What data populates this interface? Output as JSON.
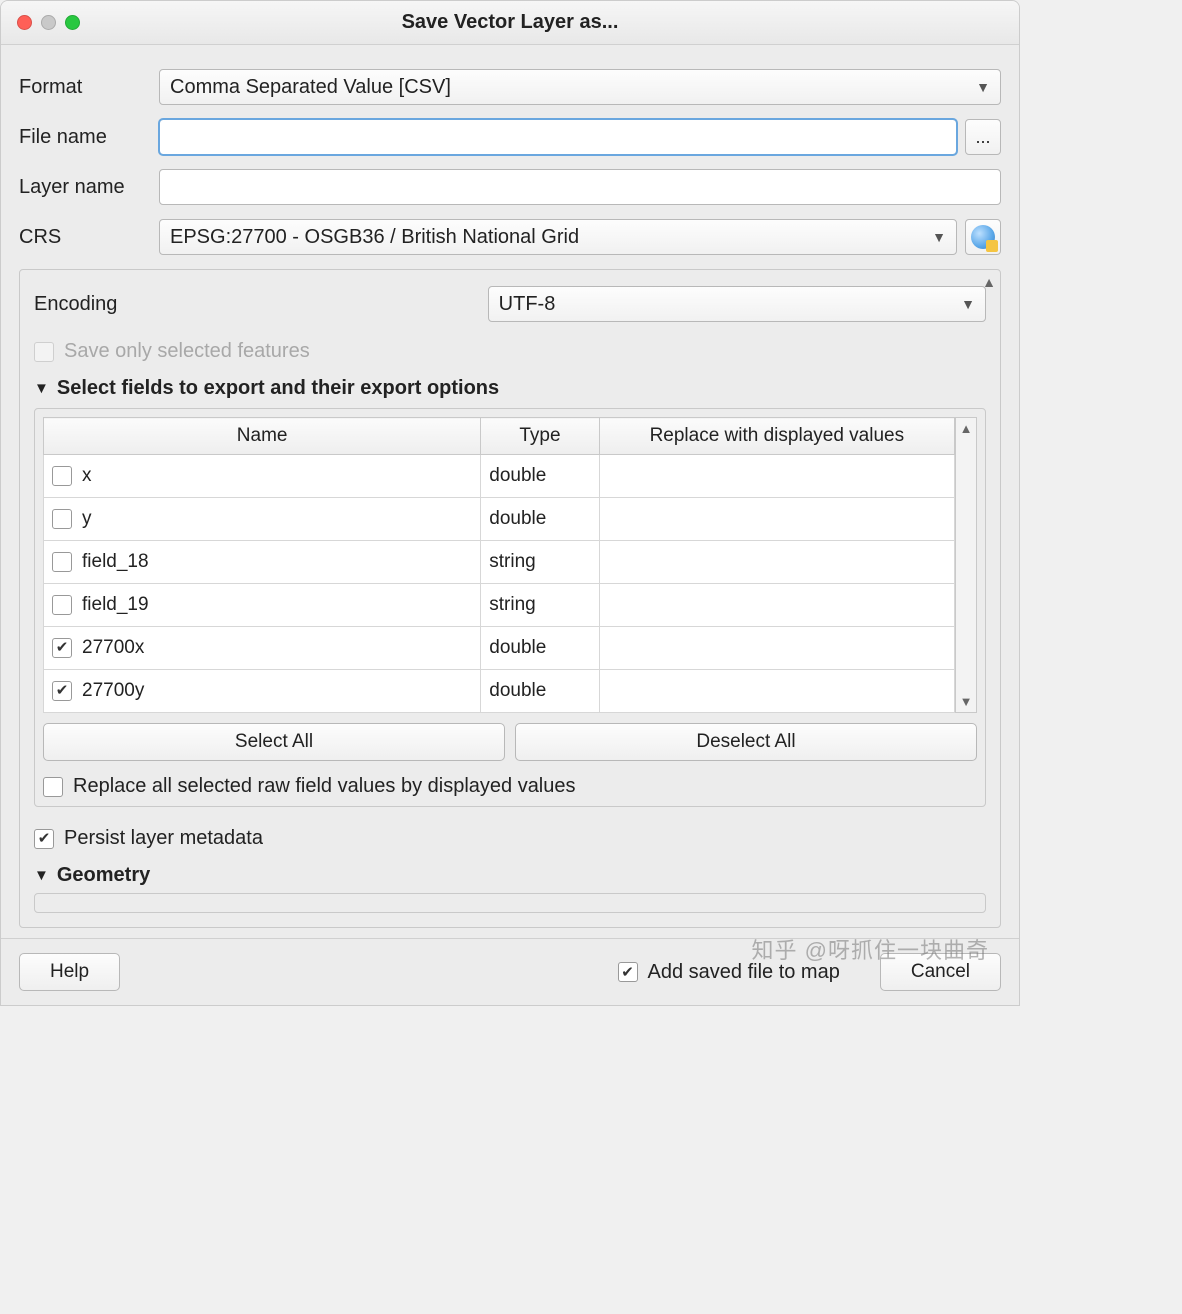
{
  "window": {
    "title": "Save Vector Layer as..."
  },
  "form": {
    "format": {
      "label": "Format",
      "value": "Comma Separated Value [CSV]"
    },
    "file_name": {
      "label": "File name",
      "value": "",
      "browse": "..."
    },
    "layer_name": {
      "label": "Layer name",
      "value": ""
    },
    "crs": {
      "label": "CRS",
      "value": "EPSG:27700 - OSGB36 / British National Grid"
    }
  },
  "encoding": {
    "label": "Encoding",
    "value": "UTF-8"
  },
  "save_only_selected": {
    "label": "Save only selected features",
    "checked": false,
    "enabled": false
  },
  "fields_section": {
    "title": "Select fields to export and their export options",
    "columns": {
      "name": "Name",
      "type": "Type",
      "replace": "Replace with displayed values"
    },
    "rows": [
      {
        "checked": false,
        "name": "x",
        "type": "double"
      },
      {
        "checked": false,
        "name": "y",
        "type": "double"
      },
      {
        "checked": false,
        "name": "field_18",
        "type": "string"
      },
      {
        "checked": false,
        "name": "field_19",
        "type": "string"
      },
      {
        "checked": true,
        "name": "27700x",
        "type": "double"
      },
      {
        "checked": true,
        "name": "27700y",
        "type": "double"
      }
    ],
    "select_all": "Select All",
    "deselect_all": "Deselect All",
    "replace_all": {
      "label": "Replace all selected raw field values by displayed values",
      "checked": false
    }
  },
  "persist_metadata": {
    "label": "Persist layer metadata",
    "checked": true
  },
  "geometry_section": {
    "title": "Geometry"
  },
  "footer": {
    "help": "Help",
    "add_to_map": {
      "label": "Add saved file to map",
      "checked": true
    },
    "cancel": "Cancel"
  },
  "watermark": "知乎 @呀抓住一块曲奇"
}
